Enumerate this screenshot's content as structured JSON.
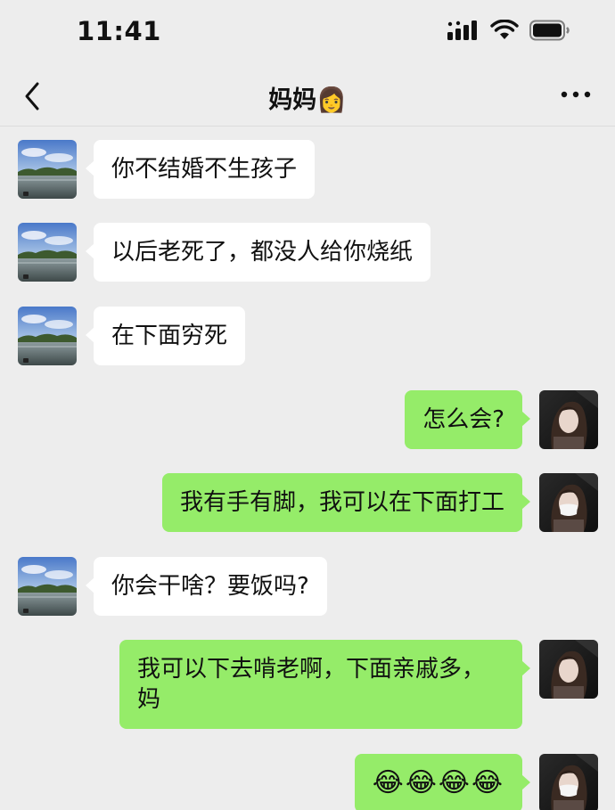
{
  "status_bar": {
    "time": "11:41"
  },
  "nav": {
    "title": "妈妈",
    "title_emoji": "👩"
  },
  "messages": [
    {
      "side": "left",
      "text": "你不结婚不生孩子"
    },
    {
      "side": "left",
      "text": "以后老死了，都没人给你烧纸"
    },
    {
      "side": "left",
      "text": "在下面穷死"
    },
    {
      "side": "right",
      "text": "怎么会?"
    },
    {
      "side": "right",
      "text": "我有手有脚，我可以在下面打工"
    },
    {
      "side": "left",
      "text": "你会干啥？要饭吗?"
    },
    {
      "side": "right",
      "text": "我可以下去啃老啊，下面亲戚多，妈"
    },
    {
      "side": "right",
      "text": "😂😂😂😂"
    }
  ],
  "colors": {
    "background": "#ededed",
    "left_bubble": "#ffffff",
    "right_bubble": "#95ec69"
  },
  "icons": [
    "signal-icon",
    "wifi-icon",
    "battery-icon",
    "back-arrow-icon",
    "more-icon"
  ]
}
